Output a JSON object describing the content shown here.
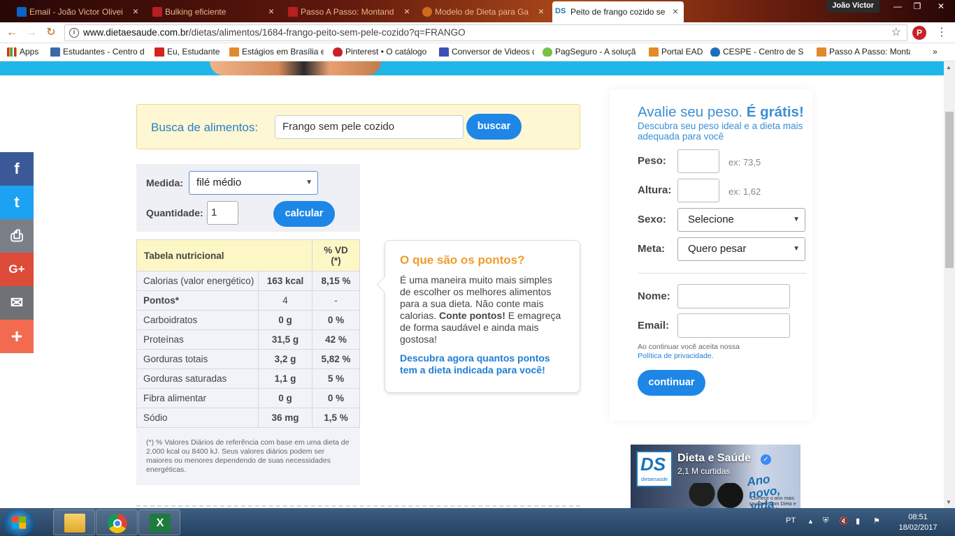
{
  "browser": {
    "tabs": [
      {
        "label": "Email - João Victor Olivei",
        "favicon_color": "#0b64c4"
      },
      {
        "label": "Bulking eficiente",
        "favicon_color": "#b52020"
      },
      {
        "label": "Passo A Passo: Montand",
        "favicon_color": "#b52020"
      },
      {
        "label": "Modelo de Dieta para Ga",
        "favicon_color": "#d26a1c"
      },
      {
        "label": "Peito de frango cozido se",
        "favicon_text": "DS",
        "favicon_color": "#1a74b8"
      }
    ],
    "user_name": "João Victor",
    "url_host": "www.dietaesaude.com.br",
    "url_path": "/dietas/alimentos/1684-frango-peito-sem-pele-cozido?q=FRANGO",
    "bookmarks": [
      {
        "label": "Apps",
        "icon_color": "#c0392b"
      },
      {
        "label": "Estudantes - Centro d",
        "icon_color": "#3a6aa5"
      },
      {
        "label": "Eu, Estudante",
        "icon_color": "#d4221f"
      },
      {
        "label": "Estágios em Brasília e",
        "icon_color": "#e28a2a"
      },
      {
        "label": "Pinterest • O catálogo",
        "icon_color": "#cb2027"
      },
      {
        "label": "Conversor de Videos d",
        "icon_color": "#3b4fb5"
      },
      {
        "label": "PagSeguro - A soluçã",
        "icon_color": "#7ac142"
      },
      {
        "label": "Portal EAD",
        "icon_color": "#e28a2a"
      },
      {
        "label": "CESPE - Centro de Sel",
        "icon_color": "#1e6fb8"
      },
      {
        "label": "Passo A Passo: Monta",
        "icon_color": "#e28a2a"
      }
    ],
    "bookmarks_more": "»"
  },
  "social": [
    {
      "icon": "facebook-icon",
      "glyph": "f",
      "color": "#3b5998"
    },
    {
      "icon": "twitter-icon",
      "glyph": "t",
      "color": "#1da1f2"
    },
    {
      "icon": "print-icon",
      "glyph": "⎙",
      "color": "#7b8088"
    },
    {
      "icon": "google-plus-icon",
      "glyph": "G+",
      "color": "#dd4b39"
    },
    {
      "icon": "email-icon",
      "glyph": "✉",
      "color": "#6e7277"
    },
    {
      "icon": "share-more-icon",
      "glyph": "+",
      "color": "#f26b50"
    }
  ],
  "search": {
    "label": "Busca de alimentos:",
    "value": "Frango sem pele cozido",
    "button": "buscar"
  },
  "measure": {
    "medida_label": "Medida:",
    "medida_value": "filé médio",
    "quantidade_label": "Quantidade:",
    "quantidade_value": "1",
    "button": "calcular"
  },
  "nutrition": {
    "header_name": "Tabela nutricional",
    "header_vd": "% VD",
    "header_vd2": "(*)",
    "rows": [
      {
        "name": "Calorias (valor energético)",
        "value": "163 kcal",
        "pct": "8,15 %",
        "bold": false
      },
      {
        "name": "Pontos*",
        "value": "4",
        "pct": "-",
        "bold": true
      },
      {
        "name": "Carboidratos",
        "value": "0 g",
        "pct": "0 %",
        "bold": false
      },
      {
        "name": "Proteínas",
        "value": "31,5 g",
        "pct": "42 %",
        "bold": false
      },
      {
        "name": "Gorduras totais",
        "value": "3,2 g",
        "pct": "5,82 %",
        "bold": false
      },
      {
        "name": "Gorduras saturadas",
        "value": "1,1 g",
        "pct": "5 %",
        "bold": false
      },
      {
        "name": "Fibra alimentar",
        "value": "0 g",
        "pct": "0 %",
        "bold": false
      },
      {
        "name": "Sódio",
        "value": "36 mg",
        "pct": "1,5 %",
        "bold": false
      }
    ],
    "footnote": "(*) % Valores Diários de referência com base em uma dieta de 2.000 kcal ou 8400 kJ. Seus valores diários podem ser maiores ou menores dependendo de suas necessidades energéticas."
  },
  "points": {
    "title": "O que são os pontos?",
    "text1": "É uma maneira muito mais simples de escolher os melhores alimentos para a sua dieta. Não conte mais calorias.",
    "text_bold": "Conte pontos!",
    "text2": "E emagreça de forma saudável e ainda mais gostosa!",
    "link": "Descubra agora quantos pontos tem a dieta indicada para você!"
  },
  "weight_form": {
    "title": "Avalie seu peso.",
    "title_bold": "É grátis!",
    "subtitle": "Descubra seu peso ideal e a dieta mais adequada para você",
    "peso_label": "Peso:",
    "peso_example": "ex: 73,5",
    "altura_label": "Altura:",
    "altura_example": "ex: 1,62",
    "sexo_label": "Sexo:",
    "sexo_value": "Selecione",
    "meta_label": "Meta:",
    "meta_value": "Quero pesar",
    "nome_label": "Nome:",
    "email_label": "Email:",
    "terms_text": "Ao continuar você aceita nossa",
    "privacy_link": "Política de privacidade",
    "terms_end": ".",
    "button": "continuar"
  },
  "facebook_widget": {
    "page_name": "Dieta e Saúde",
    "likes": "2,1 M curtidas",
    "logo_text": "DS",
    "logo_sub": "dietaesaúde",
    "promo": "Ano novo, vida nova",
    "promo_sub": "Comece o ano mais saudável com Dieta e Saúde"
  },
  "taskbar": {
    "language": "PT",
    "time": "08:51",
    "date": "18/02/2017"
  }
}
